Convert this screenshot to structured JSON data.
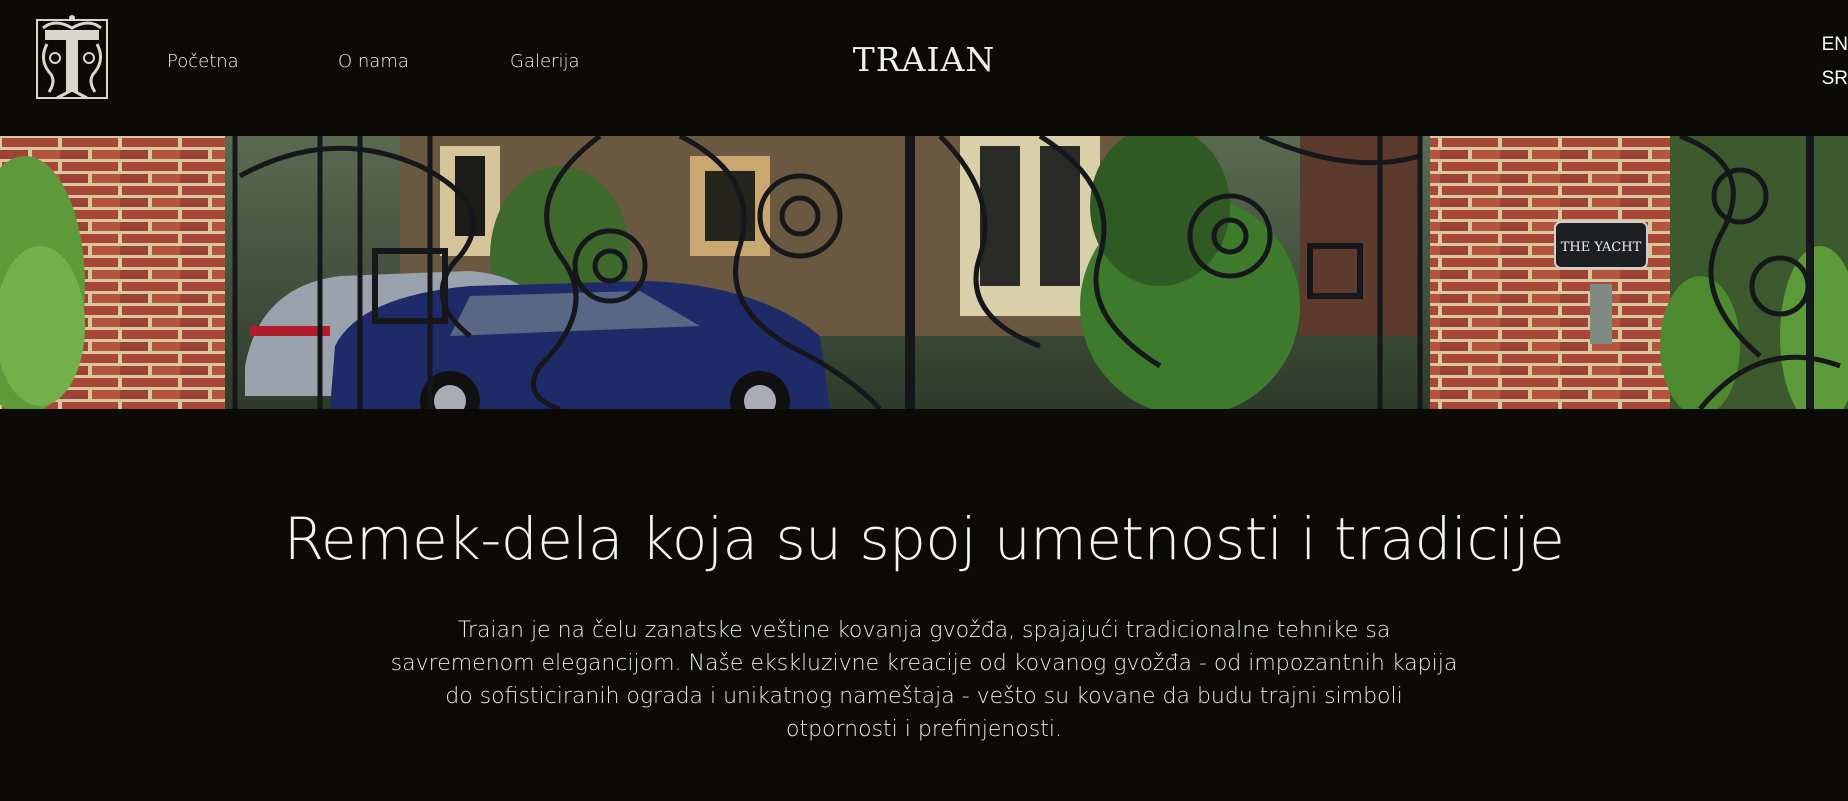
{
  "header": {
    "logo_alt": "Traian logo",
    "nav": [
      {
        "label": "Početna"
      },
      {
        "label": "O nama"
      },
      {
        "label": "Galerija"
      }
    ],
    "brand": "TRAIAN",
    "languages": [
      "EN",
      "SR"
    ]
  },
  "hero": {
    "image_subject": "wrought iron gate with brick pillars and cars",
    "sign_text": "THE YACHT"
  },
  "main": {
    "headline": "Remek-dela koja su spoj umetnosti i tradicije",
    "intro": "Traian je na čelu zanatske veštine kovanja gvožđa, spajajući tradicionalne tehnike sa savremenom elegancijom. Naše ekskluzivne kreacije od kovanog gvožđa - od impozantnih kapija do sofisticiranih ograda i unikatnog nameštaja - vešto su kovane da budu trajni simboli otpornosti i prefinjenosti."
  },
  "colors": {
    "background": "#0b0a06",
    "text": "#ffffff",
    "brick": "#a34a35",
    "iron": "#16181c"
  }
}
